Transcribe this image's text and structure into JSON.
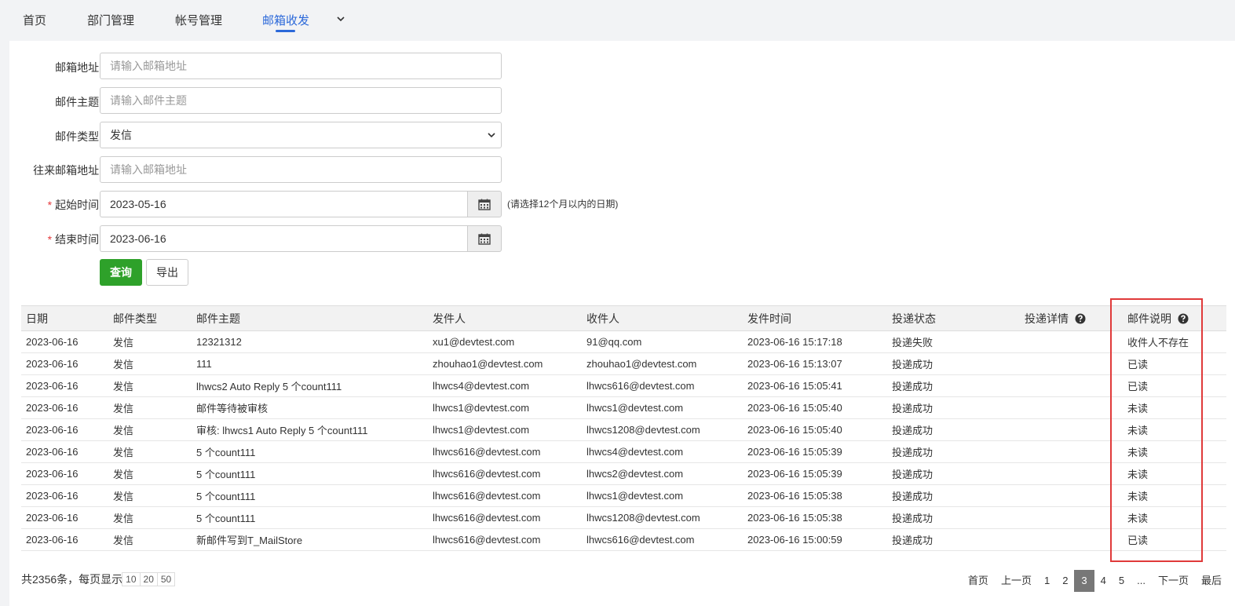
{
  "nav": {
    "items": [
      {
        "label": "首页"
      },
      {
        "label": "部门管理"
      },
      {
        "label": "帐号管理"
      },
      {
        "label": "邮箱收发"
      }
    ],
    "active_index": 3,
    "accent_color": "#2b68d9"
  },
  "form": {
    "mailbox": {
      "label": "邮箱地址:",
      "placeholder": "请输入邮箱地址",
      "value": ""
    },
    "subject": {
      "label": "邮件主题:",
      "placeholder": "请输入邮件主题",
      "value": ""
    },
    "mail_type": {
      "label": "邮件类型:",
      "selected": "发信"
    },
    "peer": {
      "label": "往来邮箱地址:",
      "placeholder": "请输入邮箱地址",
      "value": ""
    },
    "start": {
      "required_mark": "*",
      "label": "起始时间:",
      "value": "2023-05-16"
    },
    "end": {
      "required_mark": "*",
      "label": "结束时间:",
      "value": "2023-06-16"
    },
    "hint": "(请选择12个月以内的日期)",
    "query_label": "查询",
    "export_label": "导出"
  },
  "table": {
    "headers": [
      "日期",
      "邮件类型",
      "邮件主题",
      "发件人",
      "收件人",
      "发件时间",
      "投递状态",
      "投递详情",
      "邮件说明"
    ],
    "rows": [
      [
        "2023-06-16",
        "发信",
        "12321312",
        "xu1@devtest.com",
        "91@qq.com",
        "2023-06-16 15:17:18",
        "投递失败",
        "",
        "收件人不存在"
      ],
      [
        "2023-06-16",
        "发信",
        "111",
        "zhouhao1@devtest.com",
        "zhouhao1@devtest.com",
        "2023-06-16 15:13:07",
        "投递成功",
        "",
        "已读"
      ],
      [
        "2023-06-16",
        "发信",
        "lhwcs2 Auto Reply 5 个count111",
        "lhwcs4@devtest.com",
        "lhwcs616@devtest.com",
        "2023-06-16 15:05:41",
        "投递成功",
        "",
        "已读"
      ],
      [
        "2023-06-16",
        "发信",
        "邮件等待被审核",
        "lhwcs1@devtest.com",
        "lhwcs1@devtest.com",
        "2023-06-16 15:05:40",
        "投递成功",
        "",
        "未读"
      ],
      [
        "2023-06-16",
        "发信",
        "审核: lhwcs1 Auto Reply 5 个count111",
        "lhwcs1@devtest.com",
        "lhwcs1208@devtest.com",
        "2023-06-16 15:05:40",
        "投递成功",
        "",
        "未读"
      ],
      [
        "2023-06-16",
        "发信",
        "5 个count111",
        "lhwcs616@devtest.com",
        "lhwcs4@devtest.com",
        "2023-06-16 15:05:39",
        "投递成功",
        "",
        "未读"
      ],
      [
        "2023-06-16",
        "发信",
        "5 个count111",
        "lhwcs616@devtest.com",
        "lhwcs2@devtest.com",
        "2023-06-16 15:05:39",
        "投递成功",
        "",
        "未读"
      ],
      [
        "2023-06-16",
        "发信",
        "5 个count111",
        "lhwcs616@devtest.com",
        "lhwcs1@devtest.com",
        "2023-06-16 15:05:38",
        "投递成功",
        "",
        "未读"
      ],
      [
        "2023-06-16",
        "发信",
        "5 个count111",
        "lhwcs616@devtest.com",
        "lhwcs1208@devtest.com",
        "2023-06-16 15:05:38",
        "投递成功",
        "",
        "未读"
      ],
      [
        "2023-06-16",
        "发信",
        "新邮件写到T_MailStore",
        "lhwcs616@devtest.com",
        "lhwcs616@devtest.com",
        "2023-06-16 15:00:59",
        "投递成功",
        "",
        "已读"
      ]
    ]
  },
  "pager": {
    "total_text": "共2356条，每页显示",
    "sizes": [
      "10",
      "20",
      "50"
    ],
    "first": "首页",
    "prev": "上一页",
    "pages": [
      "1",
      "2",
      "3",
      "4",
      "5"
    ],
    "current": "3",
    "ellipsis": "...",
    "next": "下一页",
    "last": "最后"
  },
  "colors": {
    "query_button": "#2ea12a",
    "highlight_border": "#e03a3a"
  }
}
